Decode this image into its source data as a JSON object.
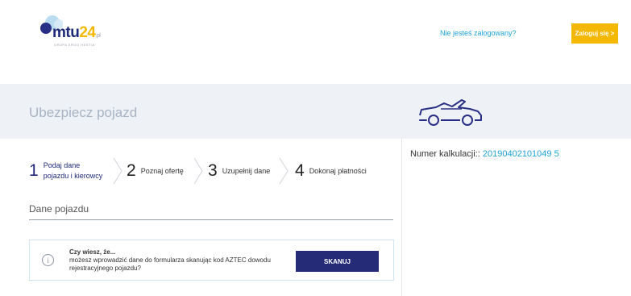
{
  "header": {
    "logo_text": "mtu",
    "logo_num": "24",
    "logo_suffix": ".pl",
    "logo_sub": "GRUPA ERGO HESTIA",
    "not_logged_label": "Nie jesteś zalogowany?",
    "login_label": "Zaloguj się >"
  },
  "banner": {
    "title": "Ubezpiecz pojazd",
    "icon": "car-icon"
  },
  "steps": [
    {
      "num": "1",
      "line1": "Podaj dane",
      "line2": "pojazdu i kierowcy",
      "active": true
    },
    {
      "num": "2",
      "line1": "Poznaj ofertę",
      "line2": "",
      "active": false
    },
    {
      "num": "3",
      "line1": "Uzupełnij dane",
      "line2": "",
      "active": false
    },
    {
      "num": "4",
      "line1": "Dokonaj płatności",
      "line2": "",
      "active": false
    }
  ],
  "section": {
    "title": "Dane pojazdu"
  },
  "info_box": {
    "icon": "info-icon",
    "title": "Czy wiesz, że...",
    "text": "możesz wprowadzić dane do formularza skanując kod AZTEC dowodu rejestracyjnego pojazdu?",
    "button_label": "SKANUJ"
  },
  "calculation": {
    "label": "Numer kalkulacji::",
    "number": "20190402101049 5"
  },
  "colors": {
    "brand_navy": "#262b78",
    "accent_yellow": "#f5b800",
    "link_blue": "#1ea3d8",
    "banner_bg": "#eef2f6"
  }
}
